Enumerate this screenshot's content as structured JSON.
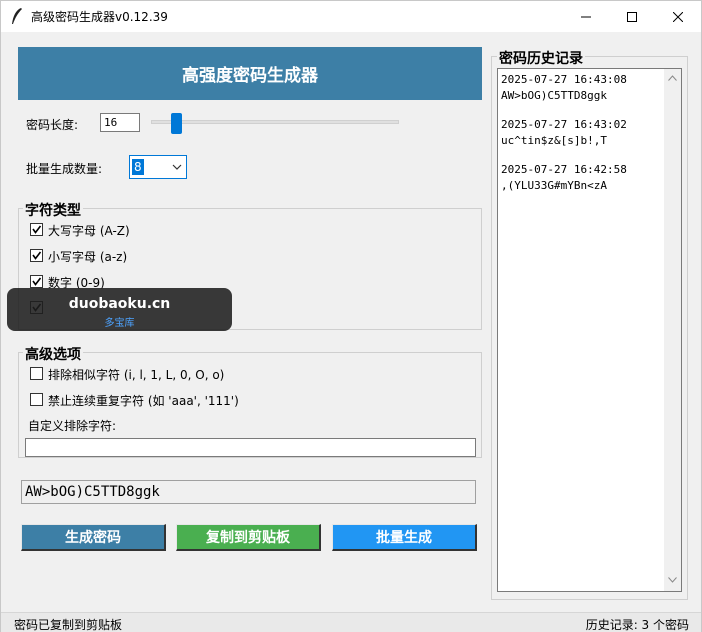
{
  "window": {
    "title": "高级密码生成器v0.12.39",
    "app_icon": "feather-icon"
  },
  "banner": {
    "title": "高强度密码生成器",
    "color": "#3d7fa6"
  },
  "length": {
    "label": "密码长度:",
    "value": "16",
    "slider_fraction": 0.08
  },
  "batch": {
    "label": "批量生成数量:",
    "selected": "8"
  },
  "char_types": {
    "title": "字符类型",
    "options": [
      {
        "label": "大写字母 (A-Z)",
        "checked": true
      },
      {
        "label": "小写字母 (a-z)",
        "checked": true
      },
      {
        "label": "数字 (0-9)",
        "checked": true
      },
      {
        "label": "",
        "checked": true
      }
    ]
  },
  "advanced": {
    "title": "高级选项",
    "options": [
      {
        "label": "排除相似字符 (i, l, 1, L, 0, O, o)",
        "checked": false
      },
      {
        "label": "禁止连续重复字符 (如 'aaa', '111')",
        "checked": false
      }
    ],
    "exclude_label": "自定义排除字符:",
    "exclude_value": ""
  },
  "output": {
    "value": "AW>bOG)C5TTD8ggk"
  },
  "buttons": {
    "generate": "生成密码",
    "copy": "复制到剪贴板",
    "batch": "批量生成",
    "colors": {
      "generate": "#3d7fa6",
      "copy": "#4aaf50",
      "batch": "#2196f3"
    }
  },
  "history": {
    "title": "密码历史记录",
    "entries": [
      {
        "time": "2025-07-27 16:43:08",
        "password": "AW>bOG)C5TTD8ggk"
      },
      {
        "time": "2025-07-27 16:43:02",
        "password": "uc^tin$z&[s]b!,T"
      },
      {
        "time": "2025-07-27 16:42:58",
        "password": ",(YLU33G#mYBn<zA"
      }
    ]
  },
  "status": {
    "left": "密码已复制到剪贴板",
    "right": "历史记录: 3 个密码"
  },
  "watermark": {
    "main": "duobaoku.cn",
    "sub": "多宝库"
  }
}
